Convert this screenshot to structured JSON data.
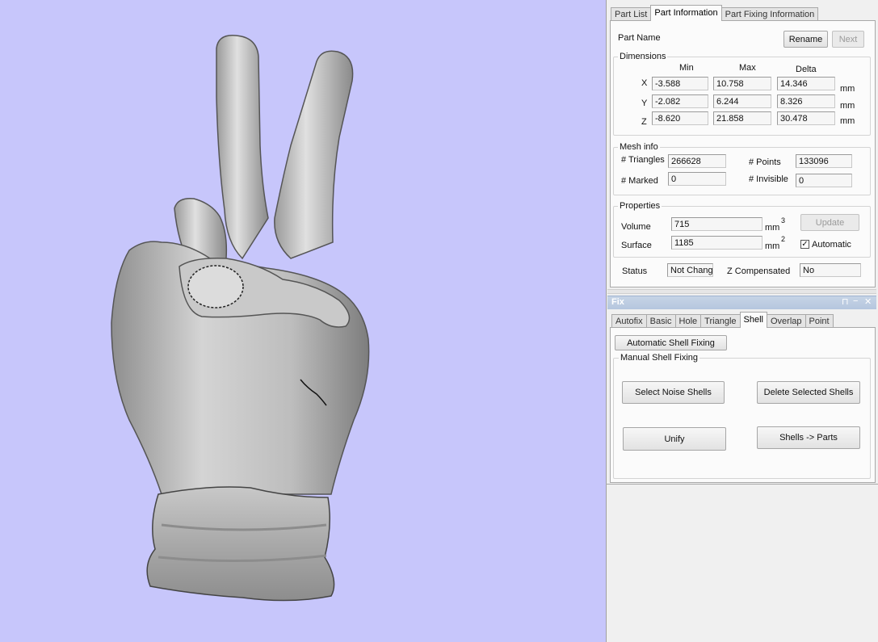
{
  "viewport": {
    "background": "#c7c6fb",
    "model_fill": "#b8b8b8",
    "model": "hand-peace-sign"
  },
  "part_panel": {
    "tabs": [
      "Part List",
      "Part Information",
      "Part Fixing Information"
    ],
    "active_tab": "Part Information",
    "part_name_label": "Part Name",
    "rename_button": "Rename",
    "next_button": "Next",
    "dimensions": {
      "title": "Dimensions",
      "headers": {
        "min": "Min",
        "max": "Max",
        "delta": "Delta"
      },
      "rows": [
        {
          "axis": "X",
          "min": "-3.588",
          "max": "10.758",
          "delta": "14.346",
          "unit": "mm"
        },
        {
          "axis": "Y",
          "min": "-2.082",
          "max": "6.244",
          "delta": "8.326",
          "unit": "mm"
        },
        {
          "axis": "Z",
          "min": "-8.620",
          "max": "21.858",
          "delta": "30.478",
          "unit": "mm"
        }
      ]
    },
    "mesh_info": {
      "title": "Mesh info",
      "triangles_label": "# Triangles",
      "triangles": "266628",
      "points_label": "# Points",
      "points": "133096",
      "marked_label": "# Marked",
      "marked": "0",
      "invisible_label": "# Invisible",
      "invisible": "0"
    },
    "properties": {
      "title": "Properties",
      "volume_label": "Volume",
      "volume": "715",
      "volume_unit": "mm",
      "volume_exp": "3",
      "surface_label": "Surface",
      "surface": "1185",
      "surface_unit": "mm",
      "surface_exp": "2",
      "update_button": "Update",
      "automatic_label": "Automatic",
      "automatic_checked": "✓"
    },
    "status": {
      "status_label": "Status",
      "status_value": "Not Changed",
      "zcomp_label": "Z Compensated",
      "zcomp_value": "No"
    }
  },
  "fix_panel": {
    "title": "Fix",
    "tabs": [
      "Autofix",
      "Basic",
      "Hole",
      "Triangle",
      "Shell",
      "Overlap",
      "Point"
    ],
    "active_tab": "Shell",
    "automatic_shell_fixing": "Automatic Shell Fixing",
    "manual_group_title": "Manual Shell Fixing",
    "select_noise_shells": "Select Noise Shells",
    "delete_selected_shells": "Delete Selected Shells",
    "unify": "Unify",
    "shells_to_parts": "Shells -> Parts"
  }
}
